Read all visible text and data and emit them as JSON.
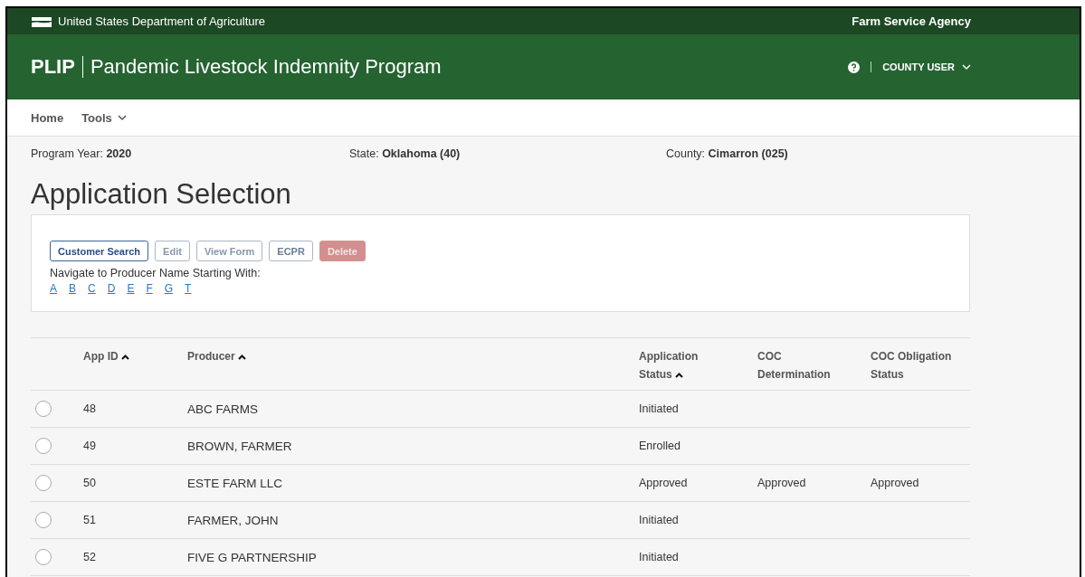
{
  "top_bar": {
    "agency": "United States Department of Agriculture",
    "right": "Farm Service Agency"
  },
  "header": {
    "acronym": "PLIP",
    "title": "Pandemic Livestock Indemnity Program",
    "user": "COUNTY USER"
  },
  "nav": [
    {
      "label": "Home",
      "dropdown": false
    },
    {
      "label": "Tools",
      "dropdown": true
    }
  ],
  "info": [
    {
      "label": "Program Year: ",
      "value": "2020"
    },
    {
      "label": "State: ",
      "value": "Oklahoma (40)"
    },
    {
      "label": "County: ",
      "value": "Cimarron (025)"
    }
  ],
  "page_title": "Application Selection",
  "buttons": [
    {
      "label": "Customer Search",
      "kind": "primary",
      "disabled": false
    },
    {
      "label": "Edit",
      "kind": "outline",
      "disabled": true
    },
    {
      "label": "View Form",
      "kind": "outline",
      "disabled": true
    },
    {
      "label": "ECPR",
      "kind": "outline",
      "disabled": false
    },
    {
      "label": "Delete",
      "kind": "danger",
      "disabled": true
    }
  ],
  "navigate_label": "Navigate to Producer Name Starting With:",
  "letters": [
    "A",
    "B",
    "C",
    "D",
    "E",
    "F",
    "G",
    "T"
  ],
  "table": {
    "columns": [
      {
        "label": "App ID",
        "sortable": true
      },
      {
        "label": "Producer",
        "sortable": true
      },
      {
        "label": "Application Status",
        "sortable": true
      },
      {
        "label": "COC Determination",
        "sortable": false
      },
      {
        "label": "COC Obligation Status",
        "sortable": false
      }
    ],
    "rows": [
      {
        "selected": false,
        "cells": [
          "48",
          "ABC FARMS",
          "Initiated",
          "",
          ""
        ]
      },
      {
        "selected": false,
        "cells": [
          "49",
          "BROWN, FARMER",
          "Enrolled",
          "",
          ""
        ]
      },
      {
        "selected": false,
        "cells": [
          "50",
          "ESTE FARM LLC",
          "Approved",
          "Approved",
          "Approved"
        ]
      },
      {
        "selected": false,
        "cells": [
          "51",
          "FARMER, JOHN",
          "Initiated",
          "",
          ""
        ]
      },
      {
        "selected": false,
        "cells": [
          "52",
          "FIVE G PARTNERSHIP",
          "Initiated",
          "",
          ""
        ]
      }
    ]
  }
}
